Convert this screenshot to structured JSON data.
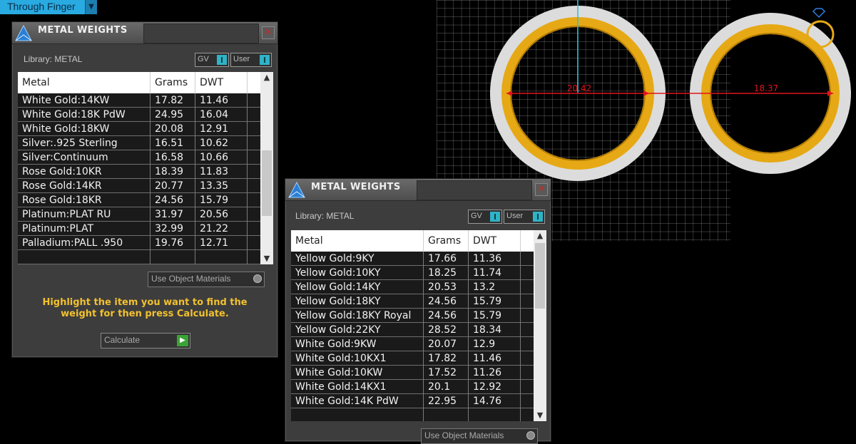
{
  "view_selector": {
    "label": "Through Finger",
    "arrow": "▼"
  },
  "viewport": {
    "dimension_left": "20.42",
    "dimension_right": "18.37",
    "colors": {
      "grid": "#8a8a8a",
      "dimension": "#e0141e",
      "gold": "#e6a915",
      "silver": "#d8d8d8",
      "axis": "#29c1d6"
    }
  },
  "panels": [
    {
      "title": "METAL WEIGHTS",
      "close": "✕",
      "library": "Library: METAL",
      "toggle_gv": "GV",
      "toggle_user": "User",
      "columns": [
        "Metal",
        "Grams",
        "DWT"
      ],
      "rows": [
        [
          "White Gold:14KW",
          "17.82",
          "11.46"
        ],
        [
          "White Gold:18K PdW",
          "24.95",
          "16.04"
        ],
        [
          "White Gold:18KW",
          "20.08",
          "12.91"
        ],
        [
          "Silver:.925 Sterling",
          "16.51",
          "10.62"
        ],
        [
          "Silver:Continuum",
          "16.58",
          "10.66"
        ],
        [
          "Rose Gold:10KR",
          "18.39",
          "11.83"
        ],
        [
          "Rose Gold:14KR",
          "20.77",
          "13.35"
        ],
        [
          "Rose Gold:18KR",
          "24.56",
          "15.79"
        ],
        [
          "Platinum:PLAT RU",
          "31.97",
          "20.56"
        ],
        [
          "Platinum:PLAT",
          "32.99",
          "21.22"
        ],
        [
          "Palladium:PALL .950",
          "19.76",
          "12.71"
        ],
        [
          "",
          "",
          ""
        ]
      ],
      "use_object_materials": "Use Object Materials",
      "hint": "Highlight the item you want to find the weight for then press Calculate.",
      "calculate": "Calculate"
    },
    {
      "title": "METAL WEIGHTS",
      "close": "✕",
      "library": "Library: METAL",
      "toggle_gv": "GV",
      "toggle_user": "User",
      "columns": [
        "Metal",
        "Grams",
        "DWT"
      ],
      "rows": [
        [
          "Yellow Gold:9KY",
          "17.66",
          "11.36"
        ],
        [
          "Yellow Gold:10KY",
          "18.25",
          "11.74"
        ],
        [
          "Yellow Gold:14KY",
          "20.53",
          "13.2"
        ],
        [
          "Yellow Gold:18KY",
          "24.56",
          "15.79"
        ],
        [
          "Yellow Gold:18KY Royal",
          "24.56",
          "15.79"
        ],
        [
          "Yellow Gold:22KY",
          "28.52",
          "18.34"
        ],
        [
          "White Gold:9KW",
          "20.07",
          "12.9"
        ],
        [
          "White Gold:10KX1",
          "17.82",
          "11.46"
        ],
        [
          "White Gold:10KW",
          "17.52",
          "11.26"
        ],
        [
          "White Gold:14KX1",
          "20.1",
          "12.92"
        ],
        [
          "White Gold:14K PdW",
          "22.95",
          "14.76"
        ],
        [
          "",
          "",
          ""
        ]
      ],
      "use_object_materials": "Use Object Materials"
    }
  ]
}
